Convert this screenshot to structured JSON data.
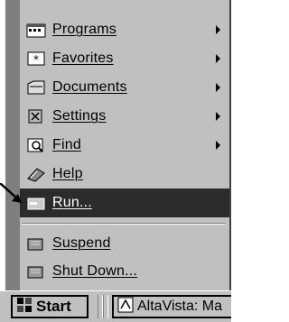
{
  "start_menu": {
    "items": [
      {
        "label": "Programs",
        "icon": "programs-icon",
        "submenu": true
      },
      {
        "label": "Favorites",
        "icon": "favorites-icon",
        "submenu": true
      },
      {
        "label": "Documents",
        "icon": "documents-icon",
        "submenu": true
      },
      {
        "label": "Settings",
        "icon": "settings-icon",
        "submenu": true
      },
      {
        "label": "Find",
        "icon": "find-icon",
        "submenu": true
      },
      {
        "label": "Help",
        "icon": "help-icon",
        "submenu": false
      },
      {
        "label": "Run...",
        "icon": "run-icon",
        "submenu": false,
        "selected": true
      }
    ],
    "power_items": [
      {
        "label": "Suspend",
        "icon": "suspend-icon"
      },
      {
        "label": "Shut Down...",
        "icon": "shutdown-icon"
      }
    ]
  },
  "taskbar": {
    "start_label": "Start",
    "task_label": "AltaVista: Ma"
  }
}
